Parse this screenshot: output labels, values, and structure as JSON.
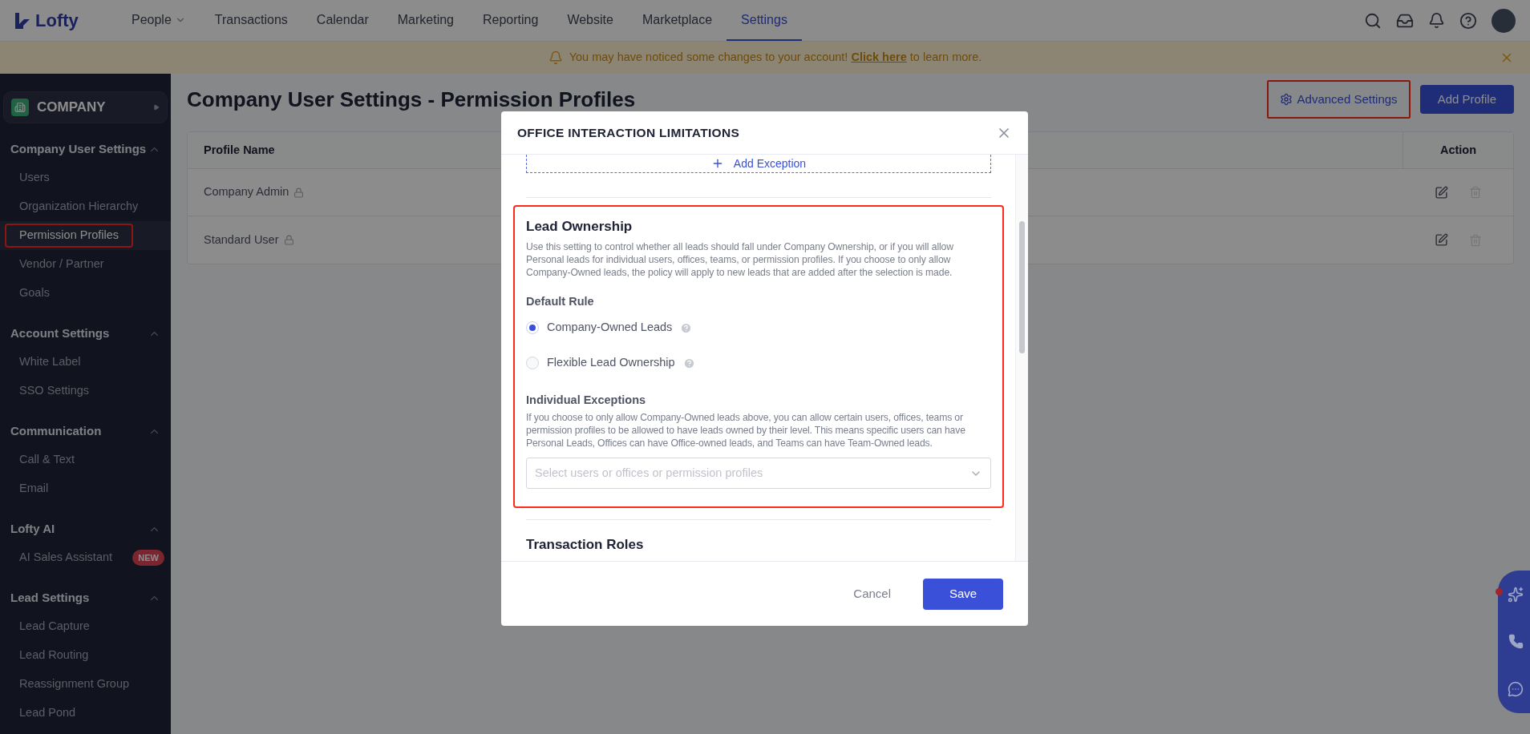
{
  "nav": {
    "logo": "Lofty",
    "items": [
      {
        "label": "People",
        "kind": "menu",
        "selected": false
      },
      {
        "label": "Transactions",
        "kind": "link",
        "selected": false
      },
      {
        "label": "Calendar",
        "kind": "link",
        "selected": false
      },
      {
        "label": "Marketing",
        "kind": "link",
        "selected": false
      },
      {
        "label": "Reporting",
        "kind": "link",
        "selected": false
      },
      {
        "label": "Website",
        "kind": "link",
        "selected": false
      },
      {
        "label": "Marketplace",
        "kind": "link",
        "selected": false
      },
      {
        "label": "Settings",
        "kind": "link",
        "selected": true
      }
    ]
  },
  "banner": {
    "text_before": "You may have noticed some changes to your account! ",
    "link": "Click here",
    "text_after": " to learn more."
  },
  "sidebar": {
    "workspace": "COMPANY",
    "sections": [
      {
        "title": "Company User Settings",
        "expanded": true,
        "items": [
          {
            "label": "Users",
            "selected": false,
            "highlighted": false
          },
          {
            "label": "Organization Hierarchy",
            "selected": false,
            "highlighted": false
          },
          {
            "label": "Permission Profiles",
            "selected": true,
            "highlighted": true
          },
          {
            "label": "Vendor / Partner",
            "selected": false,
            "highlighted": false
          },
          {
            "label": "Goals",
            "selected": false,
            "highlighted": false
          }
        ]
      },
      {
        "title": "Account Settings",
        "expanded": true,
        "items": [
          {
            "label": "White Label",
            "selected": false,
            "highlighted": false
          },
          {
            "label": "SSO Settings",
            "selected": false,
            "highlighted": false
          }
        ]
      },
      {
        "title": "Communication",
        "expanded": true,
        "items": [
          {
            "label": "Call & Text",
            "selected": false,
            "highlighted": false
          },
          {
            "label": "Email",
            "selected": false,
            "highlighted": false
          }
        ]
      },
      {
        "title": "Lofty AI",
        "expanded": true,
        "items": [
          {
            "label": "AI Sales Assistant",
            "selected": false,
            "highlighted": false,
            "badge": "NEW"
          }
        ]
      },
      {
        "title": "Lead Settings",
        "expanded": true,
        "items": [
          {
            "label": "Lead Capture",
            "selected": false,
            "highlighted": false
          },
          {
            "label": "Lead Routing",
            "selected": false,
            "highlighted": false
          },
          {
            "label": "Reassignment Group",
            "selected": false,
            "highlighted": false
          },
          {
            "label": "Lead Pond",
            "selected": false,
            "highlighted": false
          }
        ]
      }
    ]
  },
  "page": {
    "title": "Company User Settings - Permission Profiles",
    "advanced_settings": {
      "label": "Advanced Settings",
      "highlighted": true
    },
    "add_button": "Add Profile",
    "table": {
      "columns": [
        "Profile Name",
        "Action"
      ],
      "rows": [
        {
          "name": "Company Admin",
          "locked": true,
          "delete_disabled": true
        },
        {
          "name": "Standard User",
          "locked": true,
          "delete_disabled": true
        }
      ]
    }
  },
  "modal": {
    "title": "OFFICE INTERACTION LIMITATIONS",
    "add_exception": "Add Exception",
    "lead_ownership": {
      "highlighted": true,
      "title": "Lead Ownership",
      "description": "Use this setting to control whether all leads should fall under Company Ownership, or if you will allow Personal leads for individual users, offices, teams, or permission profiles. If you choose to only allow Company-Owned leads, the policy will apply to new leads that are added after the selection is made.",
      "default_rule_label": "Default Rule",
      "options": [
        {
          "label": "Company-Owned Leads",
          "selected": true
        },
        {
          "label": "Flexible Lead Ownership",
          "selected": false
        }
      ],
      "exceptions_label": "Individual Exceptions",
      "exceptions_description": "If you choose to only allow Company-Owned leads above, you can allow certain users, offices, teams or permission profiles to be allowed to have leads owned by their level. This means specific users can have Personal Leads, Offices can have Office-owned leads, and Teams can have Team-Owned leads.",
      "select_placeholder": "Select users or offices or permission profiles"
    },
    "next_section": "Transaction Roles",
    "cancel": "Cancel",
    "save": "Save"
  },
  "support_widget": {
    "notification": true
  }
}
